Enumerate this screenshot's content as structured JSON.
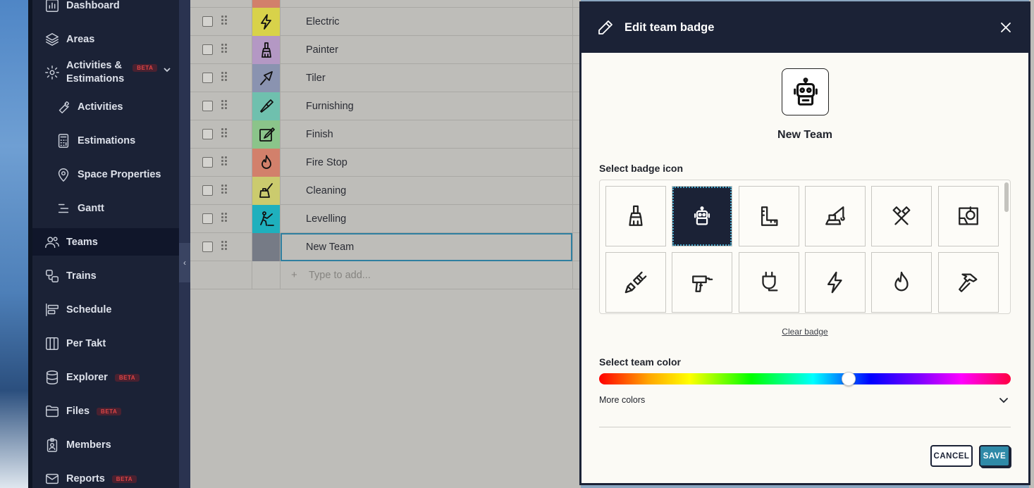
{
  "sidebar": {
    "items": [
      {
        "label": "Dashboard",
        "icon": "chart-icon"
      },
      {
        "label": "Areas",
        "icon": "layers-icon"
      },
      {
        "label": "Activities &",
        "label2": "Estimations",
        "badge": "BETA",
        "icon": "gear-icon"
      },
      {
        "label": "Activities",
        "icon": "wrench-icon"
      },
      {
        "label": "Estimations",
        "icon": "calculator-icon"
      },
      {
        "label": "Space Properties",
        "icon": "location-pin-icon"
      },
      {
        "label": "Gantt",
        "icon": "gantt-icon"
      },
      {
        "label": "Teams",
        "icon": "people-icon"
      },
      {
        "label": "Trains",
        "icon": "train-icon"
      },
      {
        "label": "Schedule",
        "icon": "schedule-icon"
      },
      {
        "label": "Per Takt",
        "icon": "columns-icon"
      },
      {
        "label": "Explorer",
        "badge": "BETA",
        "icon": "database-icon"
      },
      {
        "label": "Files",
        "badge": "BETA",
        "icon": "folder-icon"
      },
      {
        "label": "Members",
        "icon": "id-badge-icon"
      },
      {
        "label": "Reports",
        "badge": "BETA",
        "icon": "mail-icon"
      }
    ]
  },
  "teams": {
    "rows": [
      {
        "name": "Electric",
        "color": "#d8d24a",
        "icon": "lightning-icon"
      },
      {
        "name": "Painter",
        "color": "#b498c4",
        "icon": "brush-icon"
      },
      {
        "name": "Tiler",
        "color": "#8a93b0",
        "icon": "trowel-icon"
      },
      {
        "name": "Furnishing",
        "color": "#6fc0ae",
        "icon": "screwdriver-icon"
      },
      {
        "name": "Finish",
        "color": "#8bc48a",
        "icon": "finish-icon"
      },
      {
        "name": "Fire Stop",
        "color": "#d2806b",
        "icon": "fire-icon"
      },
      {
        "name": "Cleaning",
        "color": "#cbcb6e",
        "icon": "cleaning-icon"
      },
      {
        "name": "Levelling",
        "color": "#1fb0bd",
        "icon": "levelling-icon"
      },
      {
        "name": "New Team",
        "color": "#767b86",
        "icon": ""
      }
    ],
    "add_placeholder": "Type to add...",
    "add_symbol": "+"
  },
  "modal": {
    "title": "Edit team badge",
    "team_name": "New Team",
    "preview_icon": "robot-icon",
    "select_icon_label": "Select badge icon",
    "icons": [
      "brush-icon",
      "robot-icon",
      "ruler-icon",
      "crane-icon",
      "crossed-hammers-icon",
      "blueprint-icon",
      "plug-icon",
      "drill-icon",
      "socket-plug-icon",
      "lightning-icon",
      "fire-icon",
      "hammer-icon"
    ],
    "selected_icon": "robot-icon",
    "clear_badge": "Clear badge",
    "select_color_label": "Select team color",
    "hue_value": 0.605,
    "more_colors": "More colors",
    "cancel": "CANCEL",
    "save": "SAVE"
  }
}
